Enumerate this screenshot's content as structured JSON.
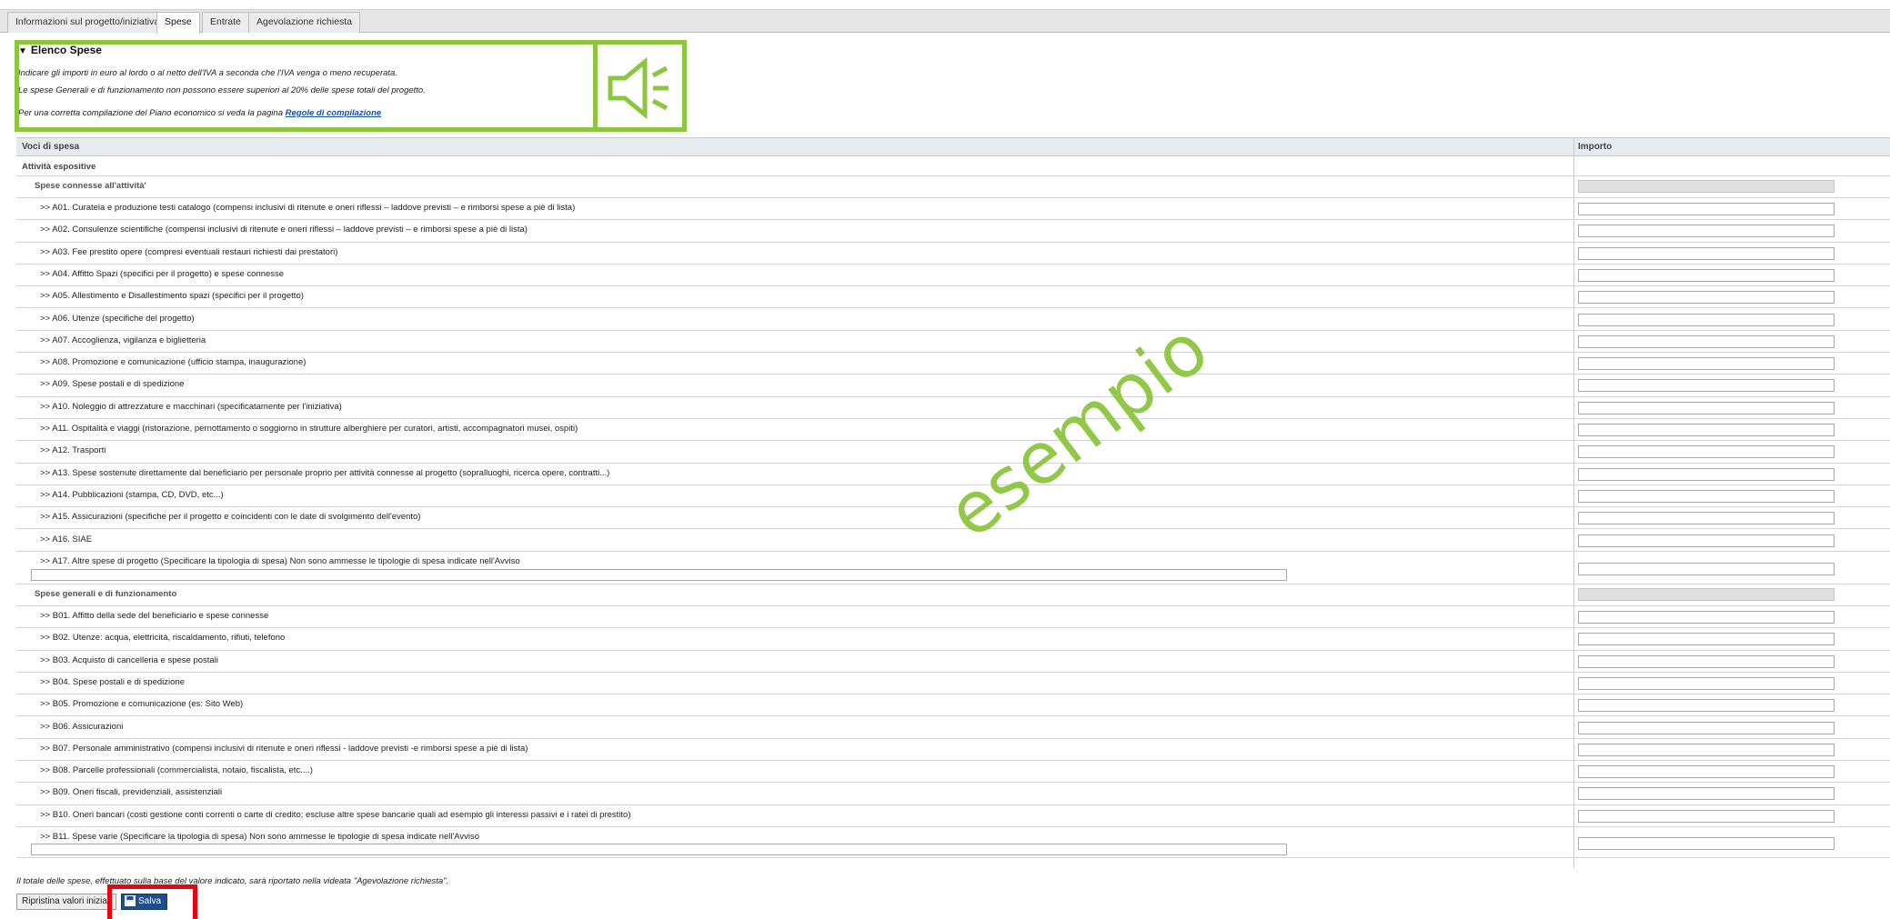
{
  "tabs": [
    {
      "label": "Informazioni sul progetto/iniziativa",
      "active": false
    },
    {
      "label": "Spese",
      "active": true
    },
    {
      "label": "Entrate",
      "active": false
    },
    {
      "label": "Agevolazione richiesta",
      "active": false
    }
  ],
  "elenco": {
    "title": "Elenco Spese",
    "line1": "Indicare gli importi in euro al lordo o al netto dell'IVA a seconda che l'IVA venga o meno recuperata.",
    "line2": "Le spese Generali e di funzionamento non possono essere superiori al 20% delle spese totali del progetto.",
    "line3_prefix": "Per una corretta compilazione del Piano economico si veda la pagina",
    "line3_link": "Regole di compilazione"
  },
  "table": {
    "col1": "Voci di spesa",
    "col2": "Importo",
    "section": "Attività espositive",
    "groupA": {
      "title": "Spese connesse all'attività'",
      "items": [
        ">> A01. Curatela e produzione testi catalogo (compensi inclusivi di ritenute e oneri riflessi – laddove previsti – e rimborsi spese a piè di lista)",
        ">> A02. Consulenze scientifiche (compensi inclusivi di ritenute e oneri riflessi – laddove previsti – e rimborsi spese a piè di lista)",
        ">> A03. Fee prestito opere (compresi eventuali restauri richiesti dai prestatori)",
        ">> A04. Affitto Spazi (specifici per il progetto) e spese connesse",
        ">> A05. Allestimento e Disallestimento spazi (specifici per il progetto)",
        ">> A06. Utenze (specifiche del progetto)",
        ">> A07. Accoglienza, vigilanza e biglietteria",
        ">> A08. Promozione e comunicazione (ufficio stampa, inaugurazione)",
        ">> A09. Spese postali e di spedizione",
        ">> A10. Noleggio di attrezzature e macchinari (specificatamente per l'iniziativa)",
        ">> A11. Ospitalità e viaggi (ristorazione, pernottamento o soggiorno in strutture alberghiere per curatori, artisti, accompagnatori musei, ospiti)",
        ">> A12. Trasporti",
        ">> A13. Spese sostenute direttamente dal beneficiario per personale proprio per attività connesse al progetto (sopralluoghi, ricerca opere, contratti...)",
        ">> A14. Pubblicazioni (stampa, CD, DVD, etc...)",
        ">> A15. Assicurazioni (specifiche per il progetto e coincidenti con le date di svolgimento dell'evento)",
        ">> A16. SIAE"
      ],
      "last_item": ">> A17. Altre spese di progetto (Specificare la tipologia di spesa) Non sono ammesse le tipologie di spesa indicate nell'Avviso"
    },
    "groupB": {
      "title": "Spese generali e di funzionamento",
      "items": [
        ">> B01. Affitto della sede del beneficiario e spese connesse",
        ">> B02. Utenze: acqua, elettricità, riscaldamento, rifiuti, telefono",
        ">> B03. Acquisto di cancelleria e spese postali",
        ">> B04. Spese postali e di spedizione",
        ">> B05. Promozione e comunicazione (es: Sito Web)",
        ">> B06. Assicurazioni",
        ">> B07. Personale amministrativo (compensi inclusivi di ritenute e oneri riflessi - laddove previsti -e rimborsi spese a piè di lista)",
        ">> B08. Parcelle professionali (commercialista, notaio, fiscalista, etc....)",
        ">> B09. Oneri fiscali, previdenziali, assistenziali",
        ">> B10. Oneri bancari (costi gestione conti correnti o carte di credito; escluse altre spese bancarie quali ad esempio gli interessi passivi e i ratei di prestito)"
      ],
      "last_item": ">> B11. Spese varie (Specificare la tipologia di spesa) Non sono ammesse le tipologie di spesa indicate nell'Avviso"
    }
  },
  "watermark": "esempio",
  "footer": {
    "note": "Il totale delle spese, effettuato sulla base del valore indicato, sarà riportato nella videata \"Agevolazione richiesta\".",
    "reset_label": "Ripristina valori iniziali",
    "save_label": "Salva"
  },
  "colors": {
    "highlight_green": "#8cc63f",
    "highlight_red": "#e30613",
    "save_button": "#1f4e8c"
  },
  "icons": {
    "speaker": "speaker-icon",
    "save": "floppy-disk-icon",
    "collapse": "triangle-down-icon"
  }
}
